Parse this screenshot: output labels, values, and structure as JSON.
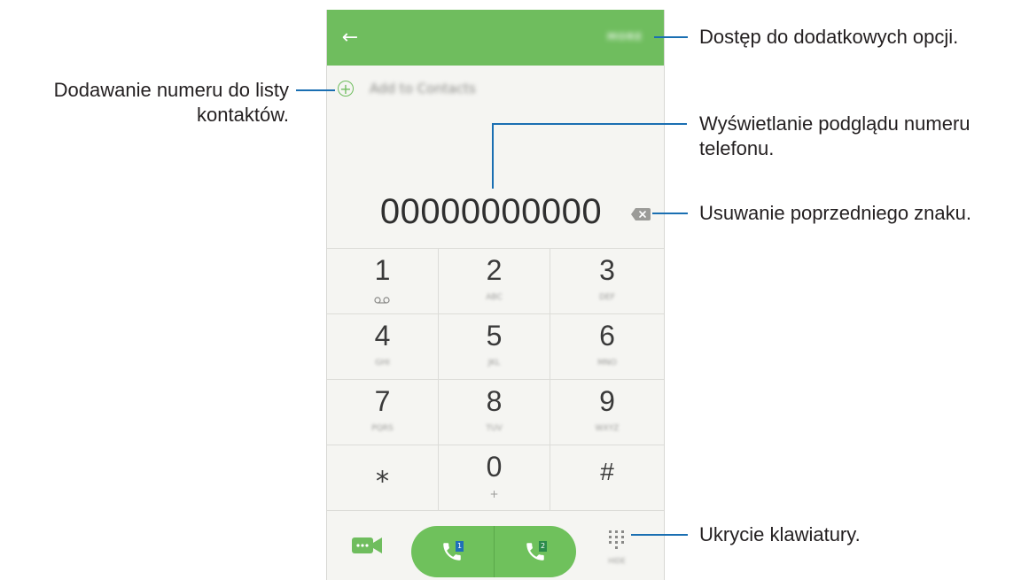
{
  "screen": {
    "add_contacts_label": "Add to Contacts",
    "more_label": "MORE",
    "number": "00000000000",
    "keys": [
      {
        "digit": "1",
        "sub": "oo"
      },
      {
        "digit": "2",
        "sub": "ABC"
      },
      {
        "digit": "3",
        "sub": "DEF"
      },
      {
        "digit": "4",
        "sub": "GHI"
      },
      {
        "digit": "5",
        "sub": "JKL"
      },
      {
        "digit": "6",
        "sub": "MNO"
      },
      {
        "digit": "7",
        "sub": "PQRS"
      },
      {
        "digit": "8",
        "sub": "TUV"
      },
      {
        "digit": "9",
        "sub": "WXYZ"
      },
      {
        "digit": "⁎",
        "sub": ""
      },
      {
        "digit": "0",
        "sub": "+"
      },
      {
        "digit": "#",
        "sub": ""
      }
    ],
    "sim1_label": "1",
    "sim2_label": "2",
    "hide_label": "HIDE",
    "accent_color": "#6fbd5e",
    "icons": [
      "back-arrow-icon",
      "add-circle-icon",
      "backspace-icon",
      "video-call-icon",
      "phone-icon",
      "keypad-icon"
    ]
  },
  "callouts": {
    "more_options": "Dostęp do dodatkowych opcji.",
    "add_contact_line1": "Dodawanie numeru do listy",
    "add_contact_line2": "kontaktów.",
    "preview_line1": "Wyświetlanie podglądu numeru",
    "preview_line2": "telefonu.",
    "delete": "Usuwanie poprzedniego znaku.",
    "hide_keypad": "Ukrycie klawiatury."
  }
}
